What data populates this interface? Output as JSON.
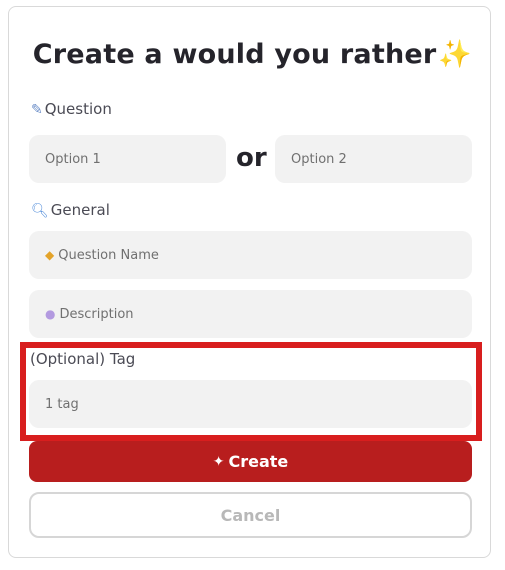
{
  "title": {
    "text": "Create a would you rather",
    "emoji": "✨"
  },
  "question_section": {
    "icon": "pencil-icon",
    "label": "Question",
    "option1_placeholder": "Option 1",
    "option2_placeholder": "Option 2",
    "or_text": "or"
  },
  "general_section": {
    "icon": "magnifier-icon",
    "label": "General",
    "question_name_placeholder": "Question Name",
    "description_placeholder": "Description"
  },
  "tag_section": {
    "label": "(Optional) Tag",
    "tag_placeholder": "1 tag"
  },
  "buttons": {
    "create_label": "Create",
    "cancel_label": "Cancel"
  },
  "colors": {
    "primary": "#b81e1e",
    "field_bg": "#f2f2f2",
    "highlight": "#d81e1e"
  }
}
